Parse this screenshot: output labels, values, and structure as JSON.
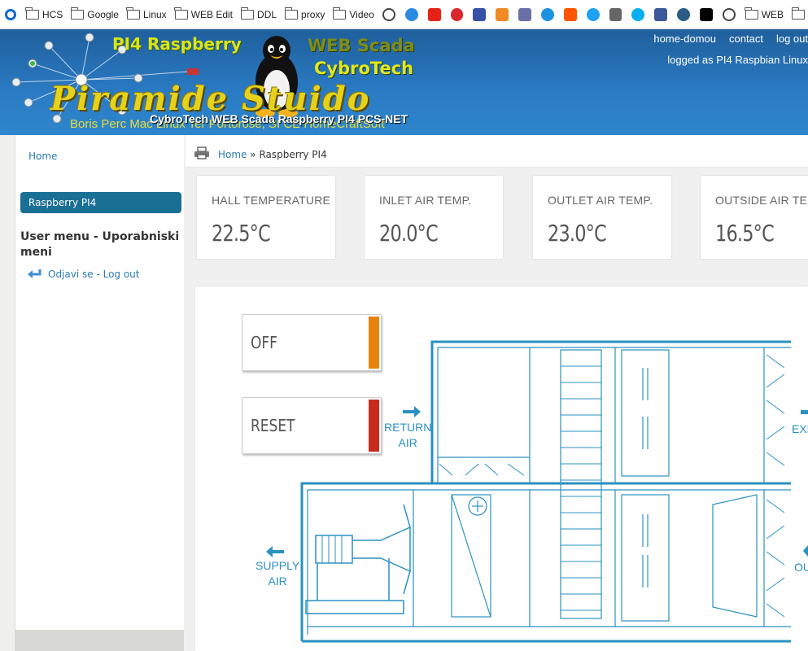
{
  "bookmarks": [
    {
      "label": "HCS"
    },
    {
      "label": "Google"
    },
    {
      "label": "Linux"
    },
    {
      "label": "WEB Edit"
    },
    {
      "label": "DDL"
    },
    {
      "label": "proxy"
    },
    {
      "label": "Video"
    }
  ],
  "bookmarks_tail": {
    "label": "WEB"
  },
  "header": {
    "brand_line1": "PI4 Raspberry",
    "brand_line2a": "WEB Scada",
    "brand_line2b": "CybroTech",
    "big_title": "Piramide Stuido",
    "subtitle": "Boris Perc Mac Linux Ter Portorose, SI CE HomeCraftSoft",
    "overlay": "CybroTech WEB Scada Raspberry PI4 PCS-NET",
    "links": [
      "home-domou",
      "contact",
      "log out"
    ],
    "logged_as": "logged as PI4 Raspbian Linux"
  },
  "sidebar": {
    "home": "Home",
    "active": "Raspberry PI4",
    "user_menu_title": "User menu - Uporabniski meni",
    "logout": "Odjavi se - Log out"
  },
  "breadcrumb": {
    "home": "Home",
    "sep": "»",
    "current": "Raspberry PI4"
  },
  "cards": [
    {
      "label": "HALL TEMPERATURE",
      "value": "22.5°C"
    },
    {
      "label": "INLET AIR TEMP.",
      "value": "20.0°C"
    },
    {
      "label": "OUTLET AIR TEMP.",
      "value": "23.0°C"
    },
    {
      "label": "OUTSIDE AIR TEMP.",
      "value": "16.5°C"
    }
  ],
  "scada": {
    "btn_off": "OFF",
    "btn_reset": "RESET",
    "return_air": [
      "RETURN",
      "AIR"
    ],
    "supply_air": [
      "SUPPLY",
      "AIR"
    ],
    "exhaust_air": "EXH",
    "outside_air": "OU",
    "colors": {
      "line": "#2a91c0",
      "off": "#e8820c",
      "reset": "#c82a1e"
    }
  }
}
